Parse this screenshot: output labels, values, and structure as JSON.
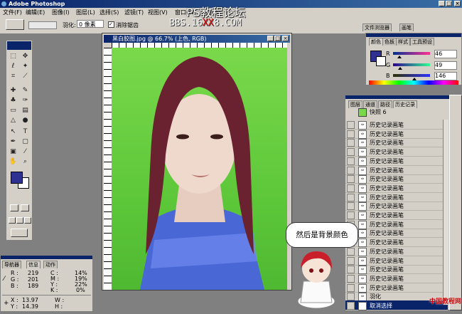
{
  "app": {
    "title": "Adobe Photoshop",
    "ps_icon": "photoshop-eye-icon"
  },
  "watermark": {
    "line1": "PS教程论坛",
    "line2_a": "BBS.16",
    "line2_b": "XX",
    "line2_c": "8.COM"
  },
  "menu": [
    "文件(F)",
    "编辑(E)",
    "图像(I)",
    "图层(L)",
    "选择(S)",
    "滤镜(T)",
    "视图(V)",
    "窗口(W)",
    "帮助(H)"
  ],
  "options": {
    "feather_label": "羽化:",
    "feather_value": "0 像素",
    "antialias_label": "消除锯齿",
    "tab_browser": "文件浏览器",
    "tab_brush": "画笔"
  },
  "document": {
    "title": "黑白胶图.jpg @ 66.7% (上色, RGB)"
  },
  "color_panel": {
    "tabs": [
      "颜色",
      "色板",
      "样式",
      "工具预设"
    ],
    "r_label": "R",
    "g_label": "G",
    "b_label": "B",
    "r": "46",
    "g": "49",
    "b": "146",
    "r_frac": 0.18,
    "g_frac": 0.19,
    "b_frac": 0.57,
    "fg_color": "#2e3192"
  },
  "history_panel": {
    "tabs": [
      "图层",
      "通道",
      "路径",
      "历史记录"
    ],
    "snapshot": "快照 6",
    "items": [
      "历史记录画笔",
      "历史记录画笔",
      "历史记录画笔",
      "历史记录画笔",
      "历史记录画笔",
      "历史记录画笔",
      "历史记录画笔",
      "历史记录画笔",
      "历史记录画笔",
      "历史记录画笔",
      "历史记录画笔",
      "历史记录画笔",
      "历史记录画笔",
      "历史记录画笔",
      "历史记录画笔",
      "历史记录画笔",
      "历史记录画笔",
      "历史记录画笔",
      "历史记录画笔",
      "羽化",
      "取消选择"
    ]
  },
  "info_panel": {
    "tabs": [
      "导航器",
      "信息",
      "动作"
    ],
    "r": "219",
    "g": "201",
    "b": "189",
    "c": "14%",
    "m": "19%",
    "y": "22%",
    "k": "0%",
    "x": "13.97",
    "y_coord": "14.39",
    "r_label": "R :",
    "g_label": "G :",
    "b_label": "B :",
    "c_label": "C :",
    "m_label": "M :",
    "y_label": "Y :",
    "k_label": "K :",
    "x_label": "X :",
    "ycoord_label": "Y :",
    "w_label": "W :",
    "h_label": "H :"
  },
  "bubble": {
    "text": "然后是背景颜色"
  },
  "footer": {
    "logo": "中国教程网"
  },
  "colors": {
    "accent": "#0a246a",
    "chrome": "#d4d0c8",
    "bg": "#808080",
    "canvas_green": "#5ec83a"
  }
}
